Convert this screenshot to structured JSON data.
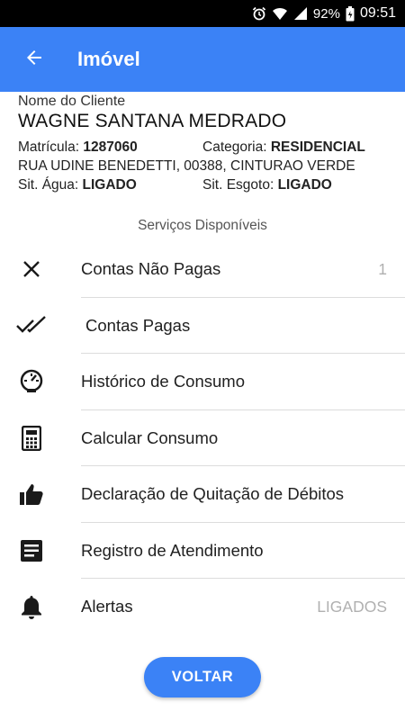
{
  "status_bar": {
    "battery": "92%",
    "time": "09:51",
    "icons": [
      "alarm-icon",
      "wifi-icon",
      "signal-icon",
      "battery-icon"
    ]
  },
  "app_bar": {
    "title": "Imóvel",
    "back_icon": "arrow-left-icon",
    "background": "#3b82f6"
  },
  "client": {
    "label": "Nome do Cliente",
    "name": "WAGNE SANTANA MEDRADO",
    "matricula_label": "Matrícula:",
    "matricula_value": "1287060",
    "categoria_label": "Categoria:",
    "categoria_value": "RESIDENCIAL",
    "address": "RUA UDINE BENEDETTI, 00388, CINTURAO VERDE",
    "agua_label": "Sit. Água:",
    "agua_value": "LIGADO",
    "esgoto_label": "Sit. Esgoto:",
    "esgoto_value": "LIGADO"
  },
  "services": {
    "title": "Serviços Disponíveis",
    "items": [
      {
        "label": "Contas Não Pagas",
        "icon": "close-icon",
        "trailing": "1"
      },
      {
        "label": "Contas Pagas",
        "icon": "double-check-icon",
        "trailing": ""
      },
      {
        "label": "Histórico de Consumo",
        "icon": "speedometer-icon",
        "trailing": ""
      },
      {
        "label": "Calcular Consumo",
        "icon": "calculator-icon",
        "trailing": ""
      },
      {
        "label": "Declaração de Quitação de Débitos",
        "icon": "thumbs-up-icon",
        "trailing": ""
      },
      {
        "label": "Registro de Atendimento",
        "icon": "document-icon",
        "trailing": ""
      },
      {
        "label": "Alertas",
        "icon": "bell-icon",
        "trailing": "LIGADOS"
      }
    ]
  },
  "footer": {
    "button_label": "VOLTAR"
  }
}
